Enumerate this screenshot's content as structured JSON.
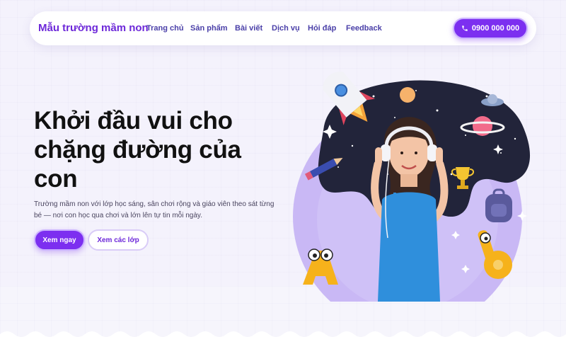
{
  "brand": {
    "name": "Mẫu trường mầm non"
  },
  "nav": {
    "links": [
      "Trang chủ",
      "Sản phẩm",
      "Bài viết",
      "Dịch vụ",
      "Hỏi đáp",
      "Feedback"
    ]
  },
  "phone": {
    "label": "0900 000 000",
    "icon": "phone-icon"
  },
  "hero": {
    "title": "Khởi đầu vui cho chặng đường của con",
    "description": "Trường mầm non với lớp học sáng, sân chơi rộng và giáo viên theo sát từng bé — nơi con học qua chơi và lớn lên tự tin mỗi ngày.",
    "primary_button": "Xem ngay",
    "secondary_button": "Xem các lớp"
  },
  "colors": {
    "accent": "#7c2ff0",
    "brand_text": "#6d28d9",
    "nav_text": "#4a3fa8",
    "background": "#f4f2fc",
    "blob": "#c9b8f5",
    "night_sky": "#22243a"
  }
}
